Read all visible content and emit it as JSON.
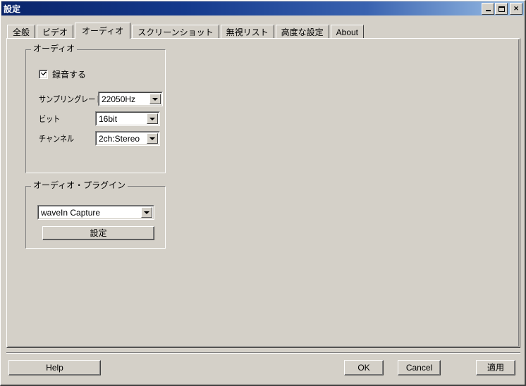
{
  "window": {
    "title": "設定",
    "controls": {
      "minimize": "Minimize",
      "maximize": "Maximize",
      "close": "✕"
    }
  },
  "tabs": [
    {
      "label": "全般",
      "active": false
    },
    {
      "label": "ビデオ",
      "active": false
    },
    {
      "label": "オーディオ",
      "active": true
    },
    {
      "label": "スクリーンショット",
      "active": false
    },
    {
      "label": "無視リスト",
      "active": false
    },
    {
      "label": "高度な設定",
      "active": false
    },
    {
      "label": "About",
      "active": false
    }
  ],
  "audio_group": {
    "title": "オーディオ",
    "record_checkbox": {
      "label": "録音する",
      "checked": true
    },
    "fields": [
      {
        "label": "サンプリングレート",
        "value": "22050Hz"
      },
      {
        "label": "ビット",
        "value": "16bit"
      },
      {
        "label": "チャンネル",
        "value": "2ch:Stereo"
      }
    ]
  },
  "plugin_group": {
    "title": "オーディオ・プラグイン",
    "plugin_value": "waveIn Capture",
    "config_button": "設定"
  },
  "footer": {
    "help": "Help",
    "ok": "OK",
    "cancel": "Cancel",
    "apply": "適用"
  },
  "colors": {
    "face": "#d4d0c8",
    "title_left": "#0a246a",
    "title_right": "#9ec2e8",
    "field_bg": "#ffffff",
    "shadow": "#404040",
    "light": "#ffffff"
  }
}
